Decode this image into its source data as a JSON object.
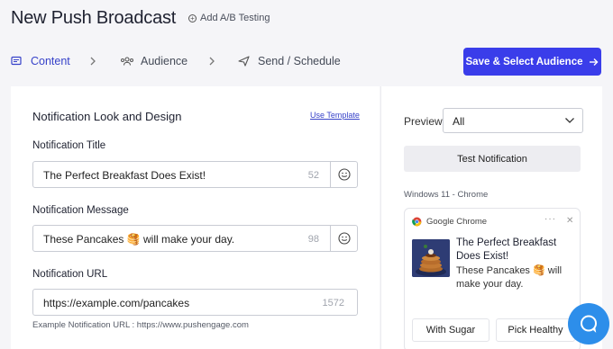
{
  "header": {
    "title": "New Push Broadcast",
    "ab_testing_label": "Add A/B Testing"
  },
  "steps": [
    {
      "label": "Content",
      "icon": "message-icon",
      "active": true
    },
    {
      "label": "Audience",
      "icon": "users-icon",
      "active": false
    },
    {
      "label": "Send / Schedule",
      "icon": "send-icon",
      "active": false
    }
  ],
  "primary_action": {
    "label": "Save & Select Audience"
  },
  "design": {
    "section_title": "Notification Look and Design",
    "use_template_label": "Use Template",
    "title_field": {
      "label": "Notification Title",
      "value": "The Perfect Breakfast Does Exist!",
      "count": "52"
    },
    "message_field": {
      "label": "Notification Message",
      "value": "These Pancakes 🥞 will make your day.",
      "count": "98"
    },
    "url_field": {
      "label": "Notification URL",
      "value": "https://example.com/pancakes",
      "count": "1572"
    },
    "url_hint": "Example Notification URL : https://www.pushengage.com"
  },
  "preview": {
    "label": "Preview",
    "selected": "All",
    "test_button": "Test Notification",
    "platform": "Windows 11 - Chrome",
    "notification": {
      "app_name": "Google Chrome",
      "title": "The Perfect Breakfast Does Exist!",
      "message": "These Pancakes 🥞 will make your day.",
      "buttons": [
        "With Sugar",
        "Pick Healthy"
      ]
    }
  },
  "colors": {
    "accent": "#3a3dea",
    "active_step": "#3742c9",
    "fab": "#2d8eea"
  }
}
